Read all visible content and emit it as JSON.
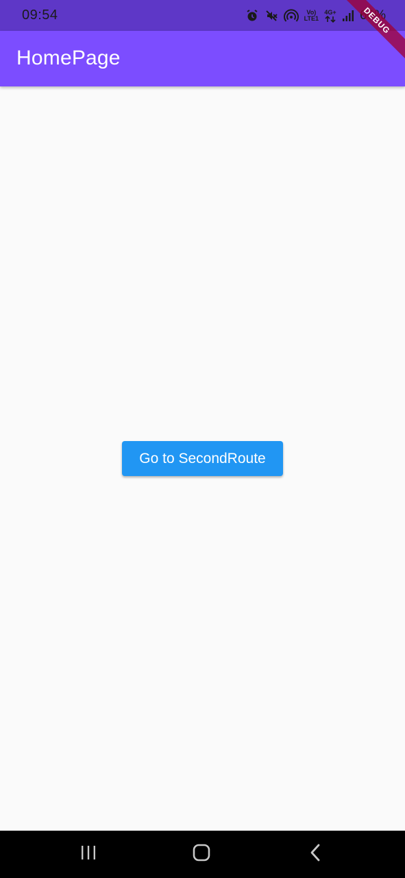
{
  "status_bar": {
    "time": "09:54",
    "network_top": "Vo)",
    "network_bottom": "LTE1",
    "data_top": "4G+",
    "battery": "60%",
    "icons": [
      "alarm-icon",
      "mute-icon",
      "hotspot-icon",
      "volte-icon",
      "data-arrows-icon",
      "signal-icon",
      "battery-icon"
    ]
  },
  "app_bar": {
    "title": "HomePage"
  },
  "debug_banner": {
    "label": "DEBUG"
  },
  "main": {
    "button_label": "Go to SecondRoute"
  },
  "nav_bar": {
    "icons": [
      "recent-apps-icon",
      "home-icon",
      "back-icon"
    ]
  },
  "colors": {
    "status_bar": "#5e37c7",
    "app_bar": "#7c4dff",
    "button": "#2196f3",
    "background": "#fafafa",
    "nav_bar": "#000000"
  }
}
